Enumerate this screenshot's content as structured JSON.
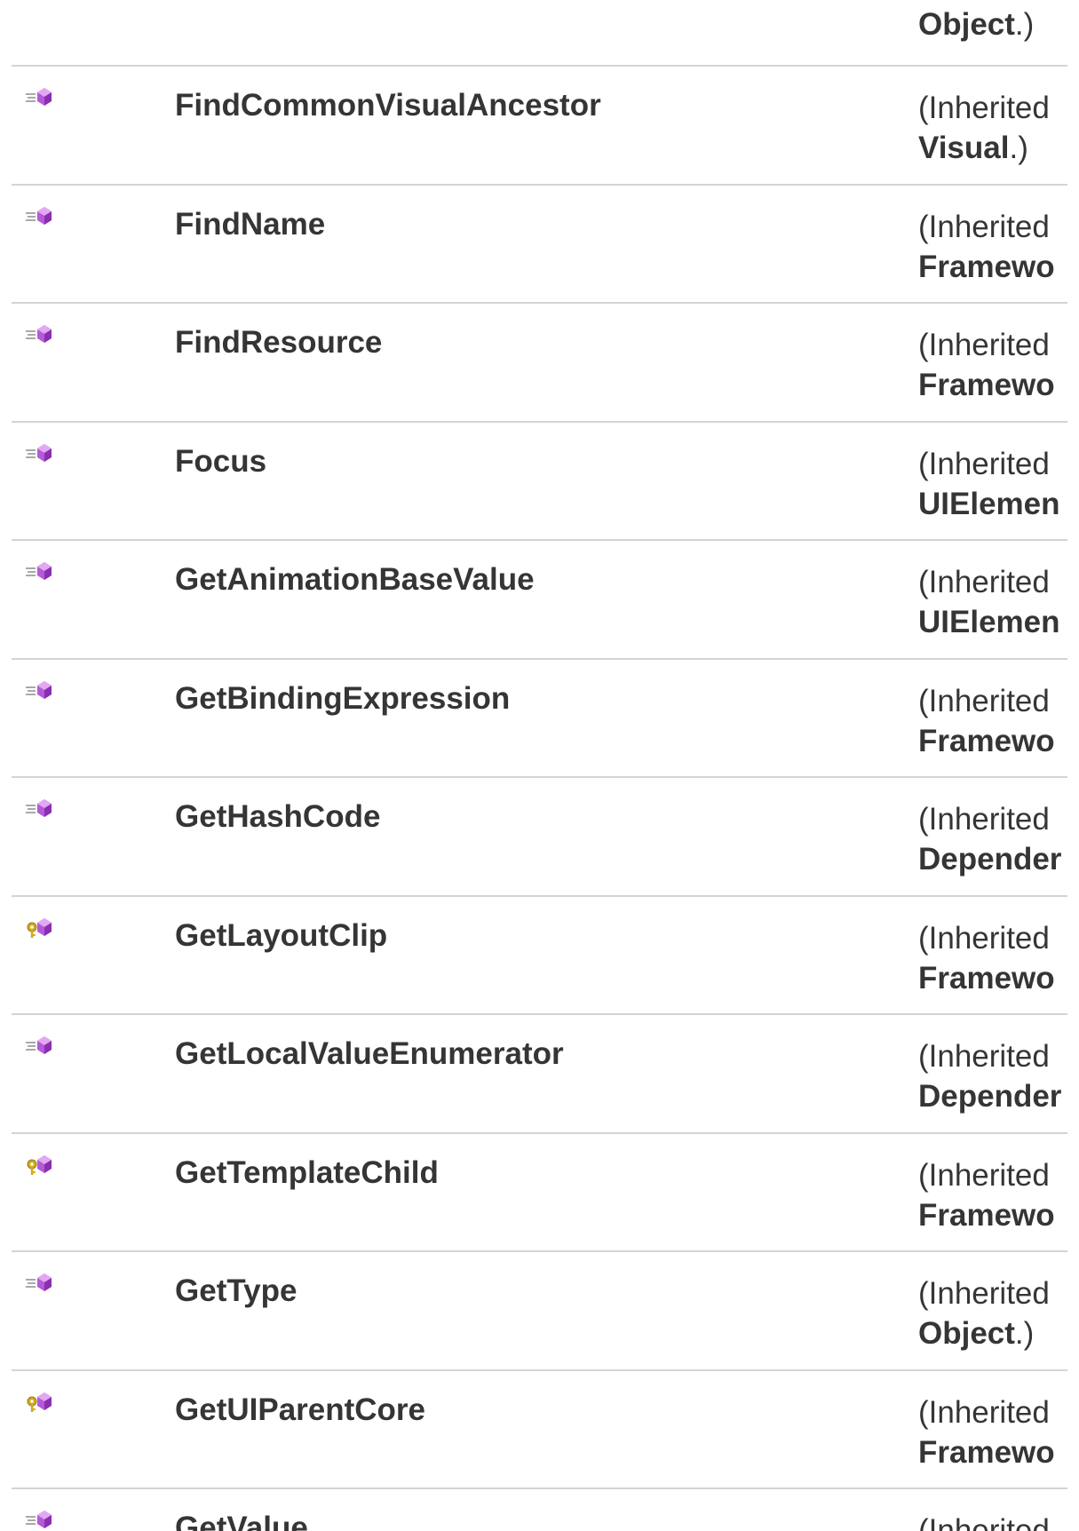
{
  "top_row": {
    "type_name": "Object",
    "suffix": ".)"
  },
  "colors": {
    "divider": "#d4d4d4",
    "text": "#353535",
    "method_icon": "#b45ad6",
    "protected_key": "#d1a91f"
  },
  "rows": [
    {
      "name": "FindCommonVisualAncestor",
      "icon": "public-method-icon",
      "inherited_prefix": "(Inherited",
      "type_name": "Visual",
      "suffix": ".)"
    },
    {
      "name": "FindName",
      "icon": "public-method-icon",
      "inherited_prefix": "(Inherited",
      "type_name": "Framewo",
      "suffix": ""
    },
    {
      "name": "FindResource",
      "icon": "public-method-icon",
      "inherited_prefix": "(Inherited",
      "type_name": "Framewo",
      "suffix": ""
    },
    {
      "name": "Focus",
      "icon": "public-method-icon",
      "inherited_prefix": "(Inherited",
      "type_name": "UIElemen",
      "suffix": ""
    },
    {
      "name": "GetAnimationBaseValue",
      "icon": "public-method-icon",
      "inherited_prefix": "(Inherited",
      "type_name": "UIElemen",
      "suffix": ""
    },
    {
      "name": "GetBindingExpression",
      "icon": "public-method-icon",
      "inherited_prefix": "(Inherited",
      "type_name": "Framewo",
      "suffix": ""
    },
    {
      "name": "GetHashCode",
      "icon": "public-method-icon",
      "inherited_prefix": "(Inherited",
      "type_name": "Depender",
      "suffix": ""
    },
    {
      "name": "GetLayoutClip",
      "icon": "protected-method-icon",
      "inherited_prefix": "(Inherited",
      "type_name": "Framewo",
      "suffix": ""
    },
    {
      "name": "GetLocalValueEnumerator",
      "icon": "public-method-icon",
      "inherited_prefix": "(Inherited",
      "type_name": "Depender",
      "suffix": ""
    },
    {
      "name": "GetTemplateChild",
      "icon": "protected-method-icon",
      "inherited_prefix": "(Inherited",
      "type_name": "Framewo",
      "suffix": ""
    },
    {
      "name": "GetType",
      "icon": "public-method-icon",
      "inherited_prefix": "(Inherited",
      "type_name": "Object",
      "suffix": ".)"
    },
    {
      "name": "GetUIParentCore",
      "icon": "protected-method-icon",
      "inherited_prefix": "(Inherited",
      "type_name": "Framewo",
      "suffix": ""
    },
    {
      "name": "GetValue",
      "icon": "public-method-icon",
      "inherited_prefix": "(Inherited",
      "type_name": "",
      "suffix": ""
    }
  ]
}
